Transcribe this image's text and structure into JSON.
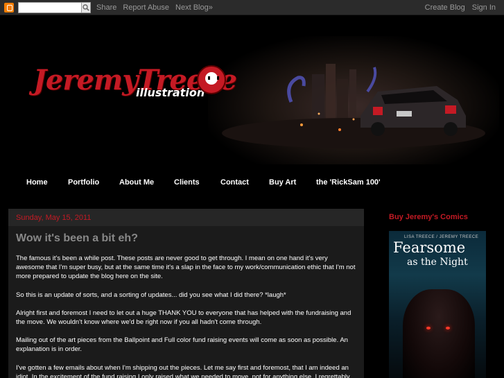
{
  "navbar": {
    "links": [
      "Share",
      "Report Abuse",
      "Next Blog»"
    ],
    "right_links": [
      "Create Blog",
      "Sign In"
    ]
  },
  "header": {
    "logo_text": "JeremyTreece",
    "logo_sub": "illustration"
  },
  "menu": {
    "items": [
      "Home",
      "Portfolio",
      "About Me",
      "Clients",
      "Contact",
      "Buy Art",
      "the 'RickSam 100'"
    ]
  },
  "post": {
    "date": "Sunday, May 15, 2011",
    "title": "Wow it's been a bit eh?",
    "paragraphs": [
      "The famous it's been a while post. These posts are never good to get through. I mean on one hand it's very awesome that I'm super busy, but at the same time it's a slap in the face to my work/communication ethic that I'm not more prepared to update the blog here on the site.",
      "So this is an update of sorts, and a sorting of updates... did you see what I did there? *laugh*",
      "Alright first and foremost I need to let out a huge THANK YOU to everyone that has helped with the fundraising and the move. We wouldn't know where we'd be right now if you all hadn't come through.",
      "Mailing out of the art pieces from the Ballpoint and Full color fund raising events will come as soon as possible. An explanation is in order.",
      "I've gotten a few emails about when I'm shipping out the pieces. Let me say first and foremost, that I am indeed an idiot. In the excitement of the fund raising I only raised what we needed to move, not for anything else. I regrettably"
    ]
  },
  "sidebar": {
    "title": "Buy Jeremy's Comics",
    "comic": {
      "credit": "LISA TREECE / JEREMY TREECE",
      "title_line1": "Fearsome",
      "title_line2": "as the Night"
    }
  }
}
